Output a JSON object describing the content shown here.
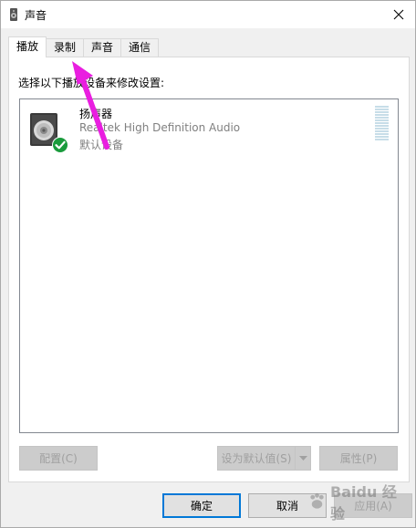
{
  "window": {
    "title": "声音",
    "close_glyph": "×"
  },
  "tabs": [
    {
      "label": "播放",
      "active": true
    },
    {
      "label": "录制",
      "active": false
    },
    {
      "label": "声音",
      "active": false
    },
    {
      "label": "通信",
      "active": false
    }
  ],
  "panel": {
    "instruction": "选择以下播放设备来修改设置:"
  },
  "devices": [
    {
      "name": "扬声器",
      "driver": "Realtek High Definition Audio",
      "status": "默认设备",
      "icon": "speaker-icon",
      "badge": "default-check-icon"
    }
  ],
  "panel_buttons": {
    "configure": "配置(C)",
    "set_default": "设为默认值(S)",
    "properties": "属性(P)"
  },
  "dialog_buttons": {
    "ok": "确定",
    "cancel": "取消",
    "apply": "应用(A)"
  },
  "watermark": {
    "text": "Baidu 经验"
  },
  "colors": {
    "accent": "#0078d7",
    "annotation_arrow": "#e91ee0",
    "check_badge": "#1a9b3c"
  }
}
